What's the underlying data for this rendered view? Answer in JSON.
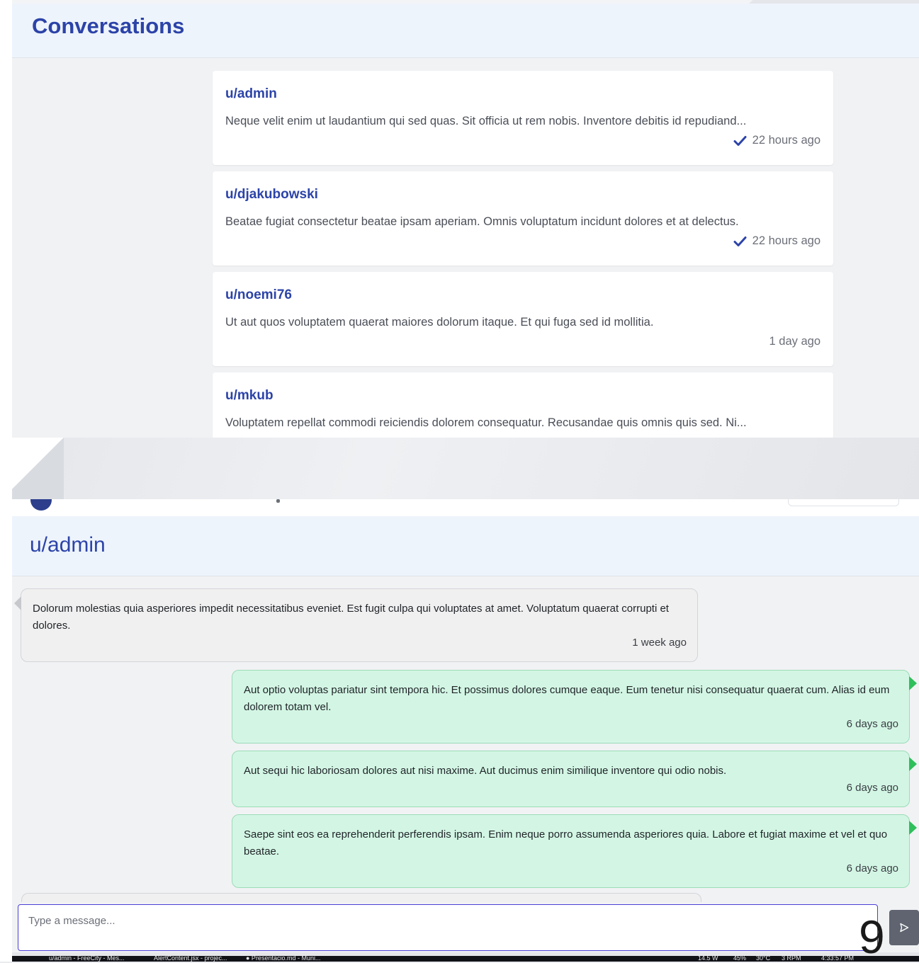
{
  "conversations": {
    "title": "Conversations",
    "items": [
      {
        "user": "u/admin",
        "snippet": "Neque velit enim ut laudantium qui sed quas. Sit officia ut rem nobis. Inventore debitis id repudiand...",
        "time": "22 hours ago",
        "read": true
      },
      {
        "user": "u/djakubowski",
        "snippet": "Beatae fugiat consectetur beatae ipsam aperiam. Omnis voluptatum incidunt dolores et at delectus.",
        "time": "22 hours ago",
        "read": true
      },
      {
        "user": "u/noemi76",
        "snippet": "Ut aut quos voluptatem quaerat maiores dolorum itaque. Et qui fuga sed id mollitia.",
        "time": "1 day ago",
        "read": false
      },
      {
        "user": "u/mkub",
        "snippet": "Voluptatem repellat commodi reiciendis dolorem consequatur. Recusandae quis omnis quis sed. Ni...",
        "time": "",
        "read": false
      }
    ]
  },
  "chat": {
    "title": "u/admin",
    "messages": [
      {
        "direction": "in",
        "text": "Dolorum molestias quia asperiores impedit necessitatibus eveniet. Est fugit culpa qui voluptates at amet. Voluptatum quaerat corrupti et dolores.",
        "time": "1 week ago"
      },
      {
        "direction": "out",
        "text": "Aut optio voluptas pariatur sint tempora hic. Et possimus dolores cumque eaque. Eum tenetur nisi consequatur quaerat cum. Alias id eum dolorem totam vel.",
        "time": "6 days ago"
      },
      {
        "direction": "out",
        "text": "Aut sequi hic laboriosam dolores aut nisi maxime. Aut ducimus enim similique inventore qui odio nobis.",
        "time": "6 days ago"
      },
      {
        "direction": "out",
        "text": "Saepe sint eos ea reprehenderit perferendis ipsam. Enim neque porro assumenda asperiores quia. Labore et fugiat maxime et vel et quo beatae.",
        "time": "6 days ago"
      }
    ],
    "composer_placeholder": "Type a message...",
    "send_icon": "send-icon"
  },
  "overlay_digit": "9",
  "taskbar": {
    "items": [
      "u/admin - FreeCity - Mes...",
      "AlertContent.jsx - projec...",
      "● Presentacio.md - Muni..."
    ],
    "status": [
      "14.5 W",
      "45%",
      "30°C",
      "3 RPM",
      "4:33:57 PM"
    ]
  },
  "colors": {
    "accent": "#2c43a8",
    "header_bg": "#eef4fc",
    "outgoing_bubble": "#d3f6e4",
    "outgoing_tail": "#2fbf5b",
    "incoming_bubble": "#f0f0f0",
    "composer_border": "#4b3fd6"
  }
}
